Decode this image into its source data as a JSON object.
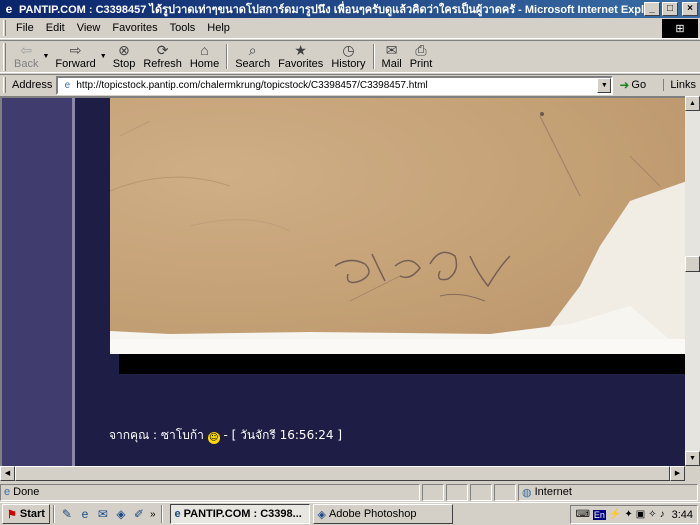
{
  "window": {
    "title": "PANTIP.COM : C3398457 ได้รูปวาดเท่าๆขนาดโปสการ์ดมารูปนึง เพื่อนๆครับดูแล้วคิดว่าใครเป็นผู้วาดครั - Microsoft Internet Explorer",
    "minimize": "_",
    "maximize": "□",
    "close": "×"
  },
  "menu": {
    "items": [
      {
        "label": "File"
      },
      {
        "label": "Edit"
      },
      {
        "label": "View"
      },
      {
        "label": "Favorites"
      },
      {
        "label": "Tools"
      },
      {
        "label": "Help"
      }
    ]
  },
  "toolbar": {
    "back": "Back",
    "forward": "Forward",
    "stop": "Stop",
    "refresh": "Refresh",
    "home": "Home",
    "search": "Search",
    "favorites": "Favorites",
    "history": "History",
    "mail": "Mail",
    "print": "Print"
  },
  "address": {
    "label": "Address",
    "url": "http://topicstock.pantip.com/chalermkrung/topicstock/C3398457/C3398457.html",
    "go": "Go",
    "links": "Links"
  },
  "content": {
    "from_line": "จากคุณ : ซาโบก้า",
    "timestamp": "- [ วันจักรี 16:56:24 ]"
  },
  "status": {
    "text": "Done",
    "zone": "Internet"
  },
  "taskbar": {
    "start": "Start",
    "tasks": [
      {
        "label": "PANTIP.COM : C3398..."
      },
      {
        "label": "Adobe Photoshop"
      }
    ],
    "lang": "En",
    "clock": "3:44"
  }
}
